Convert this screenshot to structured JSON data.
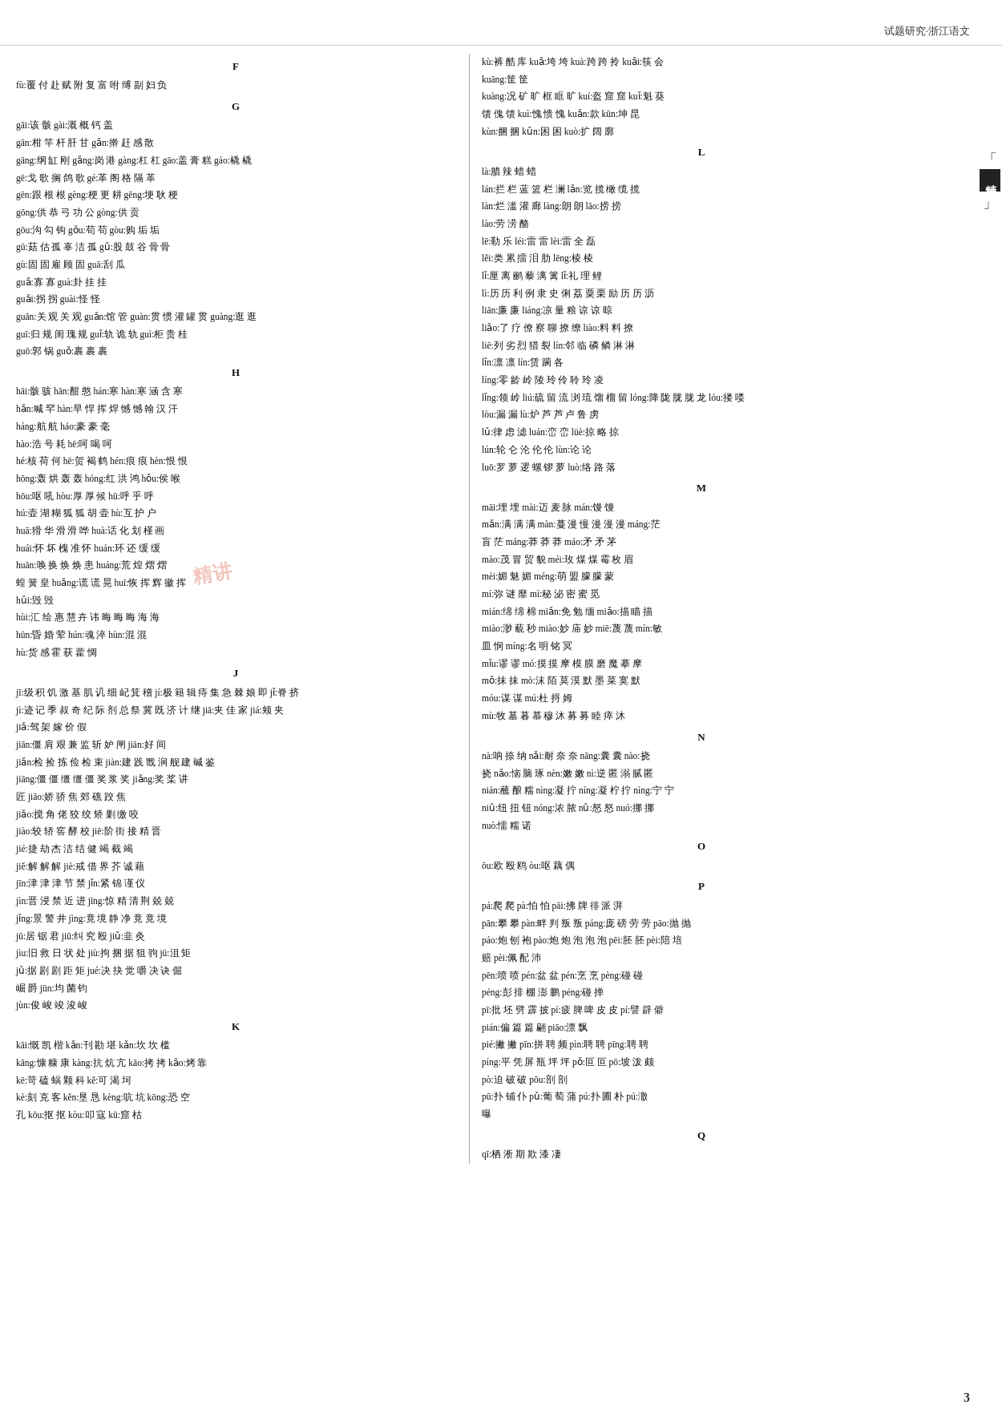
{
  "header": {
    "title": "试题研究·浙江语文"
  },
  "page_number": "3",
  "side_label": {
    "main": "精讲本",
    "bracket_top": "「",
    "bracket_bottom": "」"
  },
  "left_column": {
    "sections": [
      {
        "letter": "F",
        "content": "fù:覆 付 赴 赋 附 复 富 咐 缚 副 妇 负"
      },
      {
        "letter": "G",
        "content": "gāi:该 骸  gài:溉 概 钙 盖\ngān:柑 竿 杆 肝 甘  gǎn:擀 赶 感 散\ngāng:纲 缸 刚  gǎng:岗 港  gàng:杠 杠  gāo:盖 膏 糕  gáo:橇 橇\ngē:戈 歌 搁 鸽 歌  gé:革 阁 格 隔 革\ngēn:跟 根 根  gèng:梗 更 耕  gēng:埂 耿 梗\ngōng:供 恭 弓 功 公  gòng:供 贡\ngōu:沟 勾 钩  gǒu:苟 苟  gòu:购 垢 垢\ngū:菇 估 孤 辜 洁 孤  gǔ:股 鼓 谷 骨 骨\ngù:固 固 雇 顾 固  guā:刮 瓜\nguǎ:寡 寡  guà:卦 挂 挂\nguǎi:拐 拐  guài:怪 怪\nguān:关 观 关 观  guǎn:馆 管  guàn:贯 惯 灌 罐 贯  guàng:逛 逛\nguī:归 规 闺 瑰 规  guǐ:轨 诡 轨  guì:柜 贵 桂\nguō:郭 锅  guǒ:裹 裹 裹"
      },
      {
        "letter": "H",
        "content": "hāi:骸 骇  hān:酣 憨  hán:寒  hàn:寒 涵 含 寒\nhán:喊 罕  hàn:早 悍 挥 焊 憾 憾 翰 汉 汗\nháng:航 航  háo:豪 豪 毫\nhào:浩 号 耗  hē:呵 喝 呵\nhé:核 荷 何  hē:贺 褐 鹤  hén:痕 痕  hèn:恨 恨\nhōng:轰 烘 轰 轰  hóng:红 洪 鸿  hǒu:侯 喉\nhōu:呕 吼  hòu:厚 厚 候  hū:呼 乎 呼\nhú:壶 湖 糊 狐 狐 胡 壶  hù:互 护 户\nhuā:猾 华 滑 滑 哗  huà:话 化 划 槿 画\nhuái:怀 坏 槐 准 怀  huán:环 还 缓 缓\nhuān:唤 换 焕 焕 患  huáng:荒 煌 熠 熠\n蝗 簧 皇  huǎng:谎 谎 晃  huī:恢 挥 辉 徽 挥\nhǔi:毁 毁\nhùi:汇 绘 惠 慧 卉 讳 晦 晦 晦 海 海\nhūn:昏 婚 荤  hún:魂 淬  hùn:混 混\nhù:货 感 霍 获 藿 惆"
      },
      {
        "letter": "J",
        "content": "jī:级 积 饥 激 基 肌 讥 细 屺 箕 稽  jí:极 籍 辑 痔 集 急 棘 娘 即  jǐ:脊 挤\njì:迹 记 季 叔 奇 纪 际 剂 总 祭 冀 既 济 计 继  jiā:夹 佳 家  jiá:颊 夹\njiǎ:驾 架 嫁 价 假\njiān:僵 肩 艰 兼 监 斩 妒 闸  jiān:好 间\njiǎn:检 捡 拣 俭 检 束  jiàn:建 践 戬 涧 舰 建 碱 鉴\njiāng:僵 僵 缰 缰 僵 奖 浆 奖  jiǎng:奖 桨 讲\n匠  jiāo:娇 骄 焦 郊 礁 跤 焦\njiǎo:搅 角 佬 狡 绞 矫 剿 缴 咬\njiào:较 轿 窖 酵 校  jiē:阶 街 接 精 晋\njié:捷 劫 杰 洁 结 健 竭 截 竭\njiě:解 解 解  jiè:戒 借 界 芥 诚 藉\njīn:津 津 津 节 禁  jǐn:紧 锦 谨 仪\njìn:晋 浸 禁 近 进  jīng:惊 精 清 荆 兢 兢\njǐng:景 警 井  jìng:竟 境 静 净 竟 竟 境\njū:居 锯 君  jiū:纠 究 殴  jiǔ:韭 灸\njìu:旧 救 日 状 处  jiù:拘 捆 据 狙 驹  jū:沮 矩\njǔ:据 剧 剧 距 矩  jué:决 抉 觉 嚼 决 诀 倔\n崛 爵  jūn:均 菌 钧\njùn:俊 峻 竣 浚 峻"
      },
      {
        "letter": "K",
        "content": "kāi:慨 凯 楷  kǎn:刊 勘 堪  kǎn:坎 坎 槛\nkāng:慷 糠 康  kàng:抗 炕 亢  kāo:拷 拷  kǎo:烤 靠\nkē:苛 磕 蜗 颗 科  kě:可 渴 坷\nkè:刻 克 客  kěn:垦 恳  kèng:吭 坑  kōng:恐 空\n孔  kōu:抠 抠  kòu:叩 寇  kū:窟 枯"
      }
    ]
  },
  "right_column": {
    "sections": [
      {
        "content": "kù:裤 酷 库  kuǎ:垮 垮  kuà:跨 跨 拎  kuǎi:筷 会 kuāng:筐 筐\nkuàng:况 矿 旷 框 眶 旷  kuí:盔 窟 窟  kuǐ:魁 葵\n馈 傀 馈  kuì:愧 愦 愧  kuǎn:款  kūn:坤 昆\nkùn:捆 捆  kǔn:困 困  kuò:扩 阔 廓"
      },
      {
        "letter": "L",
        "content": "là:腊 辣 蜡 蜡\nlán:拦 栏 蓝 篮 栏 澜  lǎn:览 揽 橄 缆 揽\nlàn:烂 滥 灌 廊  làng:朗 朗  lāo:捞 捞\nlào:劳 涝 酪\nlē:勒 乐  léi:雷 雷  lèi:雷 全 磊\nlěi:类 累 擂 泪 肋  lēng:棱 棱\nlǐ:厘 离 鹂 藜 漓 篱  lǐ:礼 理 鲤\nlì:历 历 利 例 隶 史 俐 荔 粟 栗 励 历 历 沥\nliān:廉 廉  liáng:凉 量 粮 谅 谅 晾\nliǎo:了 疗 僚 察 聊 撩 缭  liào:料 料 撩\nliē:列 劣 烈 猎 裂  lín:邻 临 磷 鳞 淋 淋\nlǐn:凛 凛  lín:赁 躏 各\nlíng:零 龄 岭 陵 玲 伶 聆 玲 凌\nlǐng:领 岭  liú:硫 留 流 浏 琉 馏 榴 留  lóng:降 陇 胧 胧 龙  lóu:搂 喽\nlòu:漏 漏  lù:炉 芦 芦 卢 鲁 虏\nlǔ:律 虑 滤  luán:峦 峦  lüè:掠 略 掠\nlún:轮 仑 沦 伦 伦  lùn:论 论\nluō:罗 萝 逻 螺 锣 萝  luò:络 路 落"
      },
      {
        "letter": "M",
        "content": "māi:埋 埋  mài:迈 麦 脉  mán:馒 馒\nmǎn:满 满 满  màn:蔓 漫 慢 漫 漫 漫  máng:茫\n盲 茫  máng:莽 莽 莽  máo:矛 矛 茅\nmào:茂 冒 贸 貌  méi:玫 煤 煤 霉 枚 眉\nmèi:媚 魅 媚  méng:萌 盟 朦 朦 蒙\nmí:弥 谜 靡  mì:秘 泌 密 蜜 觅\nmián:绵 绵 棉  miǎn:免 勉 缅  miǎo:描 瞄 描\nmiào:渺 藐 秒  miào:妙 庙 妙  miē:蔑 蔑  mín:敏\n皿 悯  míng:名 明 铭 冥\nmǐu:谬 谬  mó:摸 摸 摩 模 膜 磨 魔 摹 摩\nmǒ:抹 抹  mò:沫 陌 莫 漠 默 墨 菜 寞 默\nmóu:谋 谋  mú:杜 捋 姆\nmù:牧 墓 暮 慕 穆 沐 募 募 睦 瘁 沐"
      },
      {
        "letter": "N",
        "content": "nà:呐 捺 纳  nǎi:耐 奈 奈  nāng:囊 囊  nào:挠\n挠  nǎo:恼 脑 琢  nèn:嫩 嫩  nì:逆 匿 溺 腻 匿\nnián:蘸 酿 糯  nìng:凝 拧  níng:凝 柠 拧  nìng:宁 宁\nniǔ:纽 扭 钮  nóng:浓 脓  nǔ:怒 怒  nuó:挪 挪\nnuò:懦 糯 诺"
      },
      {
        "letter": "O",
        "content": "ōu:欧 殴 鸥  òu:呕 藕 偶"
      },
      {
        "letter": "P",
        "content": "pá:爬 爬  pà:怕 怕  pāi:拂 牌 徘 派 湃\npān:攀 攀  pàn:畔 判 叛 叛  páng:庞 磅 劳 劳  pāo:抛 抛\npáo:炮 刨 袍  pào:炮 炮 泡 泡 泡  pēi:胚 胚  pèi:陪 培\n赔  pèi:佩 配 沛\npēn:喷 喷  pén:盆 盆  pén:烹 烹  pèng:碰 碰\npéng:彭 排 棚 澎 鹏  péng:碰 掸\npī:批 坯 劈 霹 披  pí:疲 脾 啤 皮 皮  pí:譬 辟 僻  pián:偏 篇 篇 翩  piāo:漂 飘\npié:撇 撇  pīn:拼 聘 频  pìn:聘 聘  pīng:聘 聘\npíng:平 凭 屏 瓶 坪 坪  pǒ:叵 叵  pō:坡 泼 颇\npò:迫 破 破  pōu:剖 剖\npū:扑 铺 仆  pǔ:葡 萄 蒲  pú:扑 圃 朴  pú:潵\n曝"
      },
      {
        "letter": "Q",
        "content": "qī:栖 淅 期 欺 漆 凄"
      }
    ]
  }
}
